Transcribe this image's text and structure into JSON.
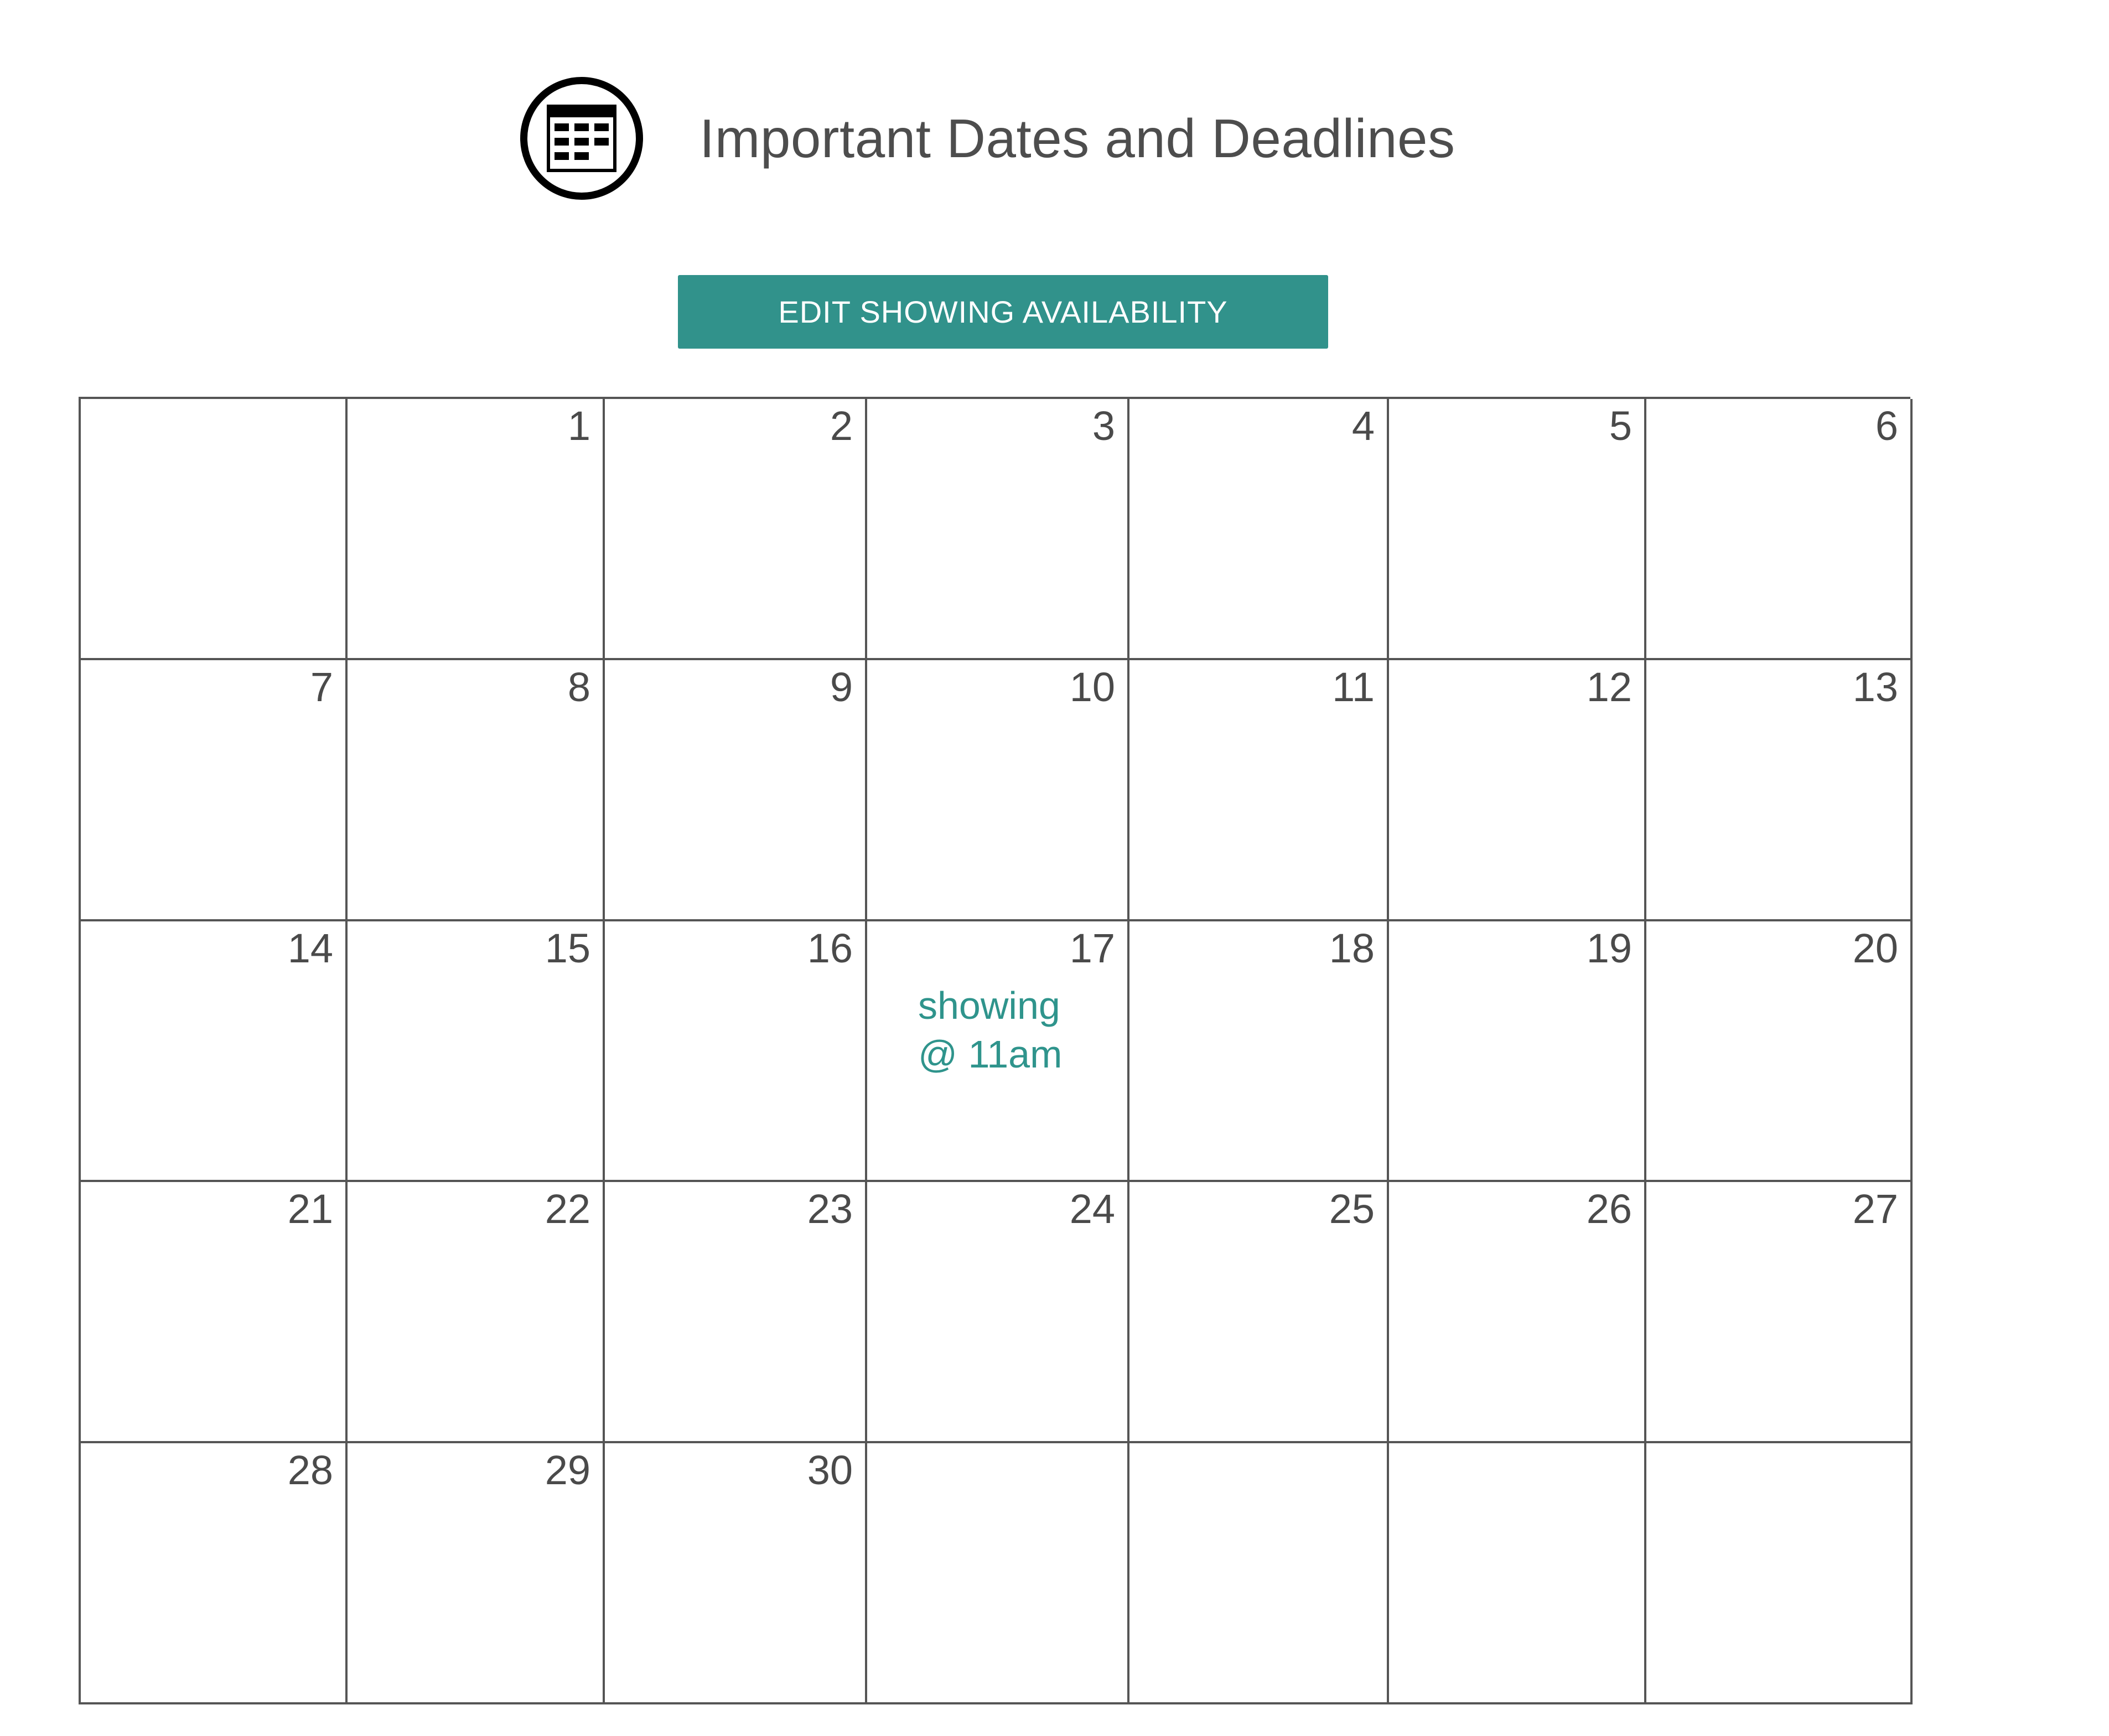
{
  "header": {
    "icon": "calendar-icon",
    "title": "Important Dates and Deadlines"
  },
  "actions": {
    "edit_availability_label": "EDIT SHOWING AVAILABILITY"
  },
  "calendar": {
    "weeks": [
      [
        "",
        "1",
        "2",
        "3",
        "4",
        "5",
        "6"
      ],
      [
        "7",
        "8",
        "9",
        "10",
        "11",
        "12",
        "13"
      ],
      [
        "14",
        "15",
        "16",
        "17",
        "18",
        "19",
        "20"
      ],
      [
        "21",
        "22",
        "23",
        "24",
        "25",
        "26",
        "27"
      ],
      [
        "28",
        "29",
        "30",
        "",
        "",
        "",
        ""
      ]
    ],
    "events": [
      {
        "day": "17",
        "text": "showing @ 11am"
      }
    ]
  },
  "colors": {
    "accent": "#31928b",
    "event_text": "#2f948c",
    "grid_line": "#555555",
    "text": "#4a4a4a"
  }
}
